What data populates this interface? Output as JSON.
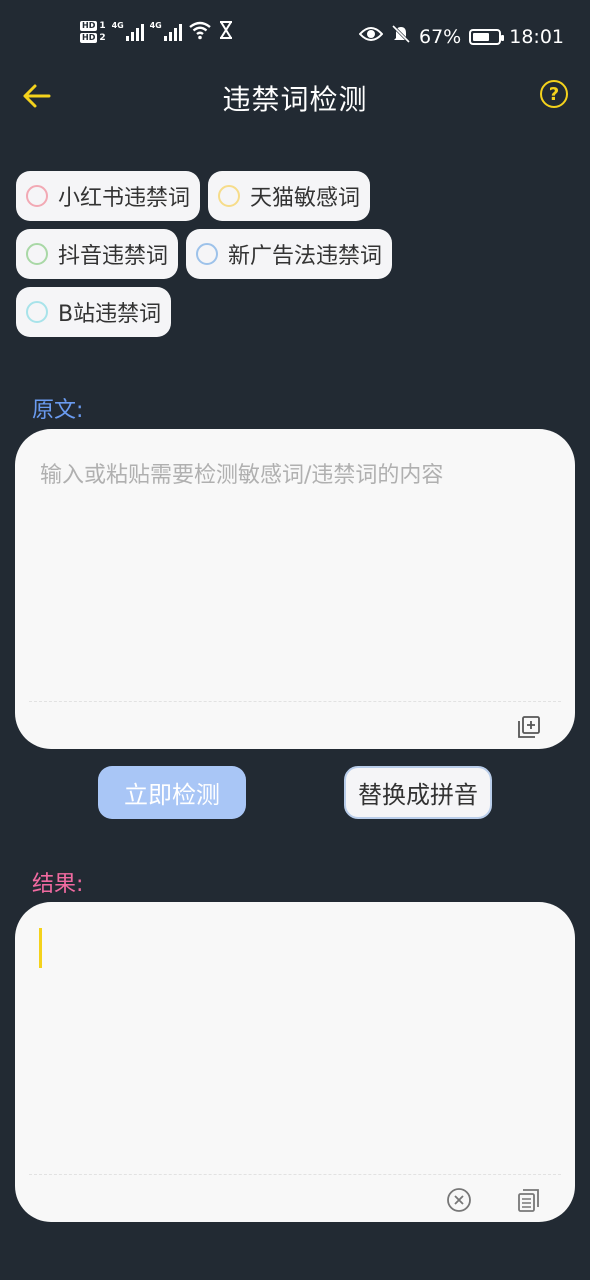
{
  "status_bar": {
    "hd1": "HD",
    "hd1_num": "1",
    "hd2": "HD",
    "hd2_num": "2",
    "net1": "4G",
    "net2": "4G",
    "battery_pct": "67%",
    "battery_level": 0.67,
    "time": "18:01",
    "icons": [
      "wifi-icon",
      "hourglass-icon",
      "eye-icon",
      "bell-muted-icon",
      "battery-icon"
    ]
  },
  "header": {
    "title": "违禁词检测",
    "back_icon": "arrow-left-icon",
    "help_label": "?",
    "accent": "#f4d21c"
  },
  "categories": [
    {
      "label": "小红书违禁词",
      "ring_color": "#f2a9b4"
    },
    {
      "label": "天猫敏感词",
      "ring_color": "#f6dc8a"
    },
    {
      "label": "抖音违禁词",
      "ring_color": "#a9d8a6"
    },
    {
      "label": "新广告法违禁词",
      "ring_color": "#9dc2ea"
    },
    {
      "label": "B站违禁词",
      "ring_color": "#a8e3ea"
    }
  ],
  "source": {
    "label": "原文:",
    "placeholder": "输入或粘贴需要检测敏感词/违禁词的内容",
    "paste_icon": "paste-add-icon"
  },
  "actions": {
    "detect_label": "立即检测",
    "pinyin_label": "替换成拼音"
  },
  "result": {
    "label": "结果:",
    "clear_icon": "clear-circle-icon",
    "copy_icon": "copy-icon"
  }
}
